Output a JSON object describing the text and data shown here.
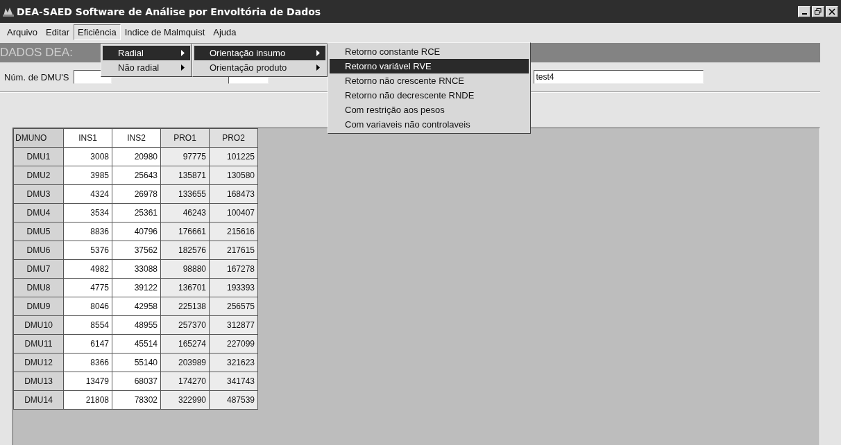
{
  "window": {
    "title": "DEA-SAED  Software de Análise por Envoltória de Dados"
  },
  "menu_bar": [
    {
      "label": "Arquivo",
      "selected": false
    },
    {
      "label": "Editar",
      "selected": false
    },
    {
      "label": "Eficiência",
      "selected": true
    },
    {
      "label": "Indice de Malmquist",
      "selected": false
    },
    {
      "label": "Ajuda",
      "selected": false
    }
  ],
  "header_band": {
    "text": "DADOS DEA:"
  },
  "form": {
    "dmu_count_label": "Núm. de DMU'S",
    "file_field_value": "test4"
  },
  "menus": [
    {
      "items": [
        {
          "label": "Radial",
          "selected": true,
          "submenu": true
        },
        {
          "label": "Não radial",
          "selected": false,
          "submenu": true
        }
      ]
    },
    {
      "items": [
        {
          "label": "Orientação insumo",
          "selected": true,
          "submenu": true
        },
        {
          "label": "Orientação produto",
          "selected": false,
          "submenu": true
        }
      ]
    },
    {
      "items": [
        {
          "label": "Retorno constante RCE",
          "selected": false,
          "submenu": false
        },
        {
          "label": "Retorno variável RVE",
          "selected": true,
          "submenu": false
        },
        {
          "label": "Retorno não crescente RNCE",
          "selected": false,
          "submenu": false
        },
        {
          "label": "Retorno não decrescente RNDE",
          "selected": false,
          "submenu": false
        },
        {
          "label": "Com restrição aos pesos",
          "selected": false,
          "submenu": false
        },
        {
          "label": "Com variaveis não controlaveis",
          "selected": false,
          "submenu": false
        }
      ]
    }
  ],
  "table": {
    "columns": [
      {
        "label": "DMUNO",
        "kind": "label"
      },
      {
        "label": "INS1",
        "kind": "input"
      },
      {
        "label": "INS2",
        "kind": "input"
      },
      {
        "label": "PRO1",
        "kind": "output"
      },
      {
        "label": "PRO2",
        "kind": "output"
      }
    ],
    "rows": [
      [
        "DMU1",
        "3008",
        "20980",
        "97775",
        "101225"
      ],
      [
        "DMU2",
        "3985",
        "25643",
        "135871",
        "130580"
      ],
      [
        "DMU3",
        "4324",
        "26978",
        "133655",
        "168473"
      ],
      [
        "DMU4",
        "3534",
        "25361",
        "46243",
        "100407"
      ],
      [
        "DMU5",
        "8836",
        "40796",
        "176661",
        "215616"
      ],
      [
        "DMU6",
        "5376",
        "37562",
        "182576",
        "217615"
      ],
      [
        "DMU7",
        "4982",
        "33088",
        "98880",
        "167278"
      ],
      [
        "DMU8",
        "4775",
        "39122",
        "136701",
        "193393"
      ],
      [
        "DMU9",
        "8046",
        "42958",
        "225138",
        "256575"
      ],
      [
        "DMU10",
        "8554",
        "48955",
        "257370",
        "312877"
      ],
      [
        "DMU11",
        "6147",
        "45514",
        "165274",
        "227099"
      ],
      [
        "DMU12",
        "8366",
        "55140",
        "203989",
        "321623"
      ],
      [
        "DMU13",
        "13479",
        "68037",
        "174270",
        "341743"
      ],
      [
        "DMU14",
        "21808",
        "78302",
        "322990",
        "487539"
      ]
    ]
  }
}
